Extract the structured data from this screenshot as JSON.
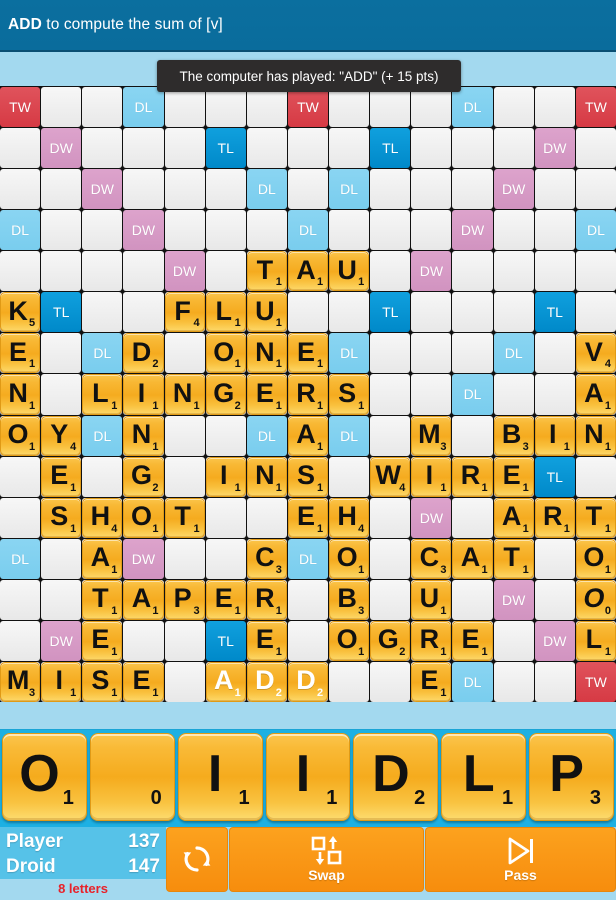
{
  "titlebar": {
    "clue_bold": "ADD",
    "clue_rest": " to compute the sum of [v]"
  },
  "toast": {
    "message": "The computer has played: \"ADD\" (+ 15 pts)"
  },
  "board": {
    "size": 15,
    "multiplier_labels": {
      "tw": "TW",
      "dw": "DW",
      "tl": "TL",
      "dl": "DL"
    },
    "colors": {
      "triple_word": "#d63a44",
      "double_word": "#d193c0",
      "triple_letter": "#0089c9",
      "double_letter": "#79cdee",
      "plain": "#eeeeee",
      "tile": "#f5ab1f",
      "grid_line": "#111111"
    },
    "multipliers": [
      [
        "tw",
        "",
        "",
        "dl",
        "",
        "",
        "",
        "tw",
        "",
        "",
        "",
        "dl",
        "",
        "",
        "tw"
      ],
      [
        "",
        "dw",
        "",
        "",
        "",
        "tl",
        "",
        "",
        "",
        "tl",
        "",
        "",
        "",
        "dw",
        ""
      ],
      [
        "",
        "",
        "dw",
        "",
        "",
        "",
        "dl",
        "",
        "dl",
        "",
        "",
        "",
        "dw",
        "",
        ""
      ],
      [
        "dl",
        "",
        "",
        "dw",
        "",
        "",
        "",
        "dl",
        "",
        "",
        "",
        "dw",
        "",
        "",
        "dl"
      ],
      [
        "",
        "",
        "",
        "",
        "dw",
        "",
        "",
        "",
        "",
        "",
        "dw",
        "",
        "",
        "",
        ""
      ],
      [
        "",
        "tl",
        "",
        "",
        "",
        "",
        "",
        "",
        "",
        "tl",
        "",
        "",
        "",
        "tl",
        ""
      ],
      [
        "",
        "",
        "dl",
        "",
        "",
        "",
        "",
        "",
        "dl",
        "",
        "",
        "",
        "dl",
        "",
        ""
      ],
      [
        "",
        "",
        "",
        "",
        "",
        "",
        "",
        "",
        "",
        "",
        "",
        "dl",
        "",
        "",
        ""
      ],
      [
        "",
        "",
        "dl",
        "",
        "",
        "",
        "dl",
        "",
        "dl",
        "",
        "",
        "",
        "",
        "",
        ""
      ],
      [
        "",
        "",
        "",
        "",
        "",
        "",
        "",
        "",
        "",
        "",
        "",
        "",
        "",
        "tl",
        ""
      ],
      [
        "",
        "",
        "",
        "",
        "",
        "",
        "",
        "",
        "",
        "",
        "dw",
        "",
        "",
        "",
        ""
      ],
      [
        "dl",
        "",
        "",
        "dw",
        "",
        "",
        "",
        "dl",
        "",
        "",
        "",
        "",
        "",
        "",
        ""
      ],
      [
        "",
        "",
        "",
        "",
        "",
        "",
        "",
        "",
        "",
        "",
        "",
        "",
        "dw",
        "",
        ""
      ],
      [
        "",
        "dw",
        "",
        "",
        "",
        "tl",
        "",
        "",
        "",
        "",
        "",
        "",
        "",
        "dw",
        ""
      ],
      [
        "",
        "",
        "",
        "",
        "",
        "",
        "",
        "",
        "",
        "",
        "",
        "dl",
        "",
        "",
        "tw"
      ]
    ],
    "tiles": [
      [
        "",
        "",
        "",
        "",
        "",
        "",
        "",
        "",
        "",
        "",
        "",
        "",
        "",
        "",
        ""
      ],
      [
        "",
        "",
        "",
        "",
        "",
        "",
        "",
        "",
        "",
        "",
        "",
        "",
        "",
        "",
        ""
      ],
      [
        "",
        "",
        "",
        "",
        "",
        "",
        "",
        "",
        "",
        "",
        "",
        "",
        "",
        "",
        ""
      ],
      [
        "",
        "",
        "",
        "",
        "",
        "",
        "",
        "",
        "",
        "",
        "",
        "",
        "",
        "",
        ""
      ],
      [
        "",
        "",
        "",
        "",
        "",
        "",
        "T1",
        "A1",
        "U1",
        "",
        "",
        "",
        "",
        "",
        ""
      ],
      [
        "K5",
        "",
        "",
        "",
        "F4",
        "L1",
        "U1",
        "",
        "",
        "",
        "",
        "",
        "",
        "",
        ""
      ],
      [
        "E1",
        "",
        "",
        "D2",
        "",
        "O1",
        "N1",
        "E1",
        "",
        "",
        "",
        "",
        "",
        "",
        "V4"
      ],
      [
        "N1",
        "",
        "L1",
        "I1",
        "N1",
        "G2",
        "E1",
        "R1",
        "S1",
        "",
        "",
        "",
        "",
        "",
        "A1"
      ],
      [
        "O1",
        "Y4",
        "",
        "N1",
        "",
        "",
        "",
        "A1",
        "",
        "",
        "M3",
        "",
        "B3",
        "I1",
        "N1"
      ],
      [
        "",
        "E1",
        "",
        "G2",
        "",
        "I1",
        "N1",
        "S1",
        "",
        "W4",
        "I1",
        "R1",
        "E1",
        "",
        ""
      ],
      [
        "",
        "S1",
        "H4",
        "O1",
        "T1",
        "",
        "",
        "E1",
        "H4",
        "",
        "",
        "",
        "A1",
        "R1",
        "T1"
      ],
      [
        "",
        "",
        "A1",
        "",
        "",
        "",
        "C3",
        "",
        "O1",
        "",
        "C3",
        "A1",
        "T1",
        "",
        "O1"
      ],
      [
        "",
        "",
        "T1",
        "A1",
        "P3",
        "E1",
        "R1",
        "",
        "B3",
        "",
        "U1",
        "",
        "",
        "",
        "*O0"
      ],
      [
        "",
        "",
        "E1",
        "",
        "",
        "",
        "E1",
        "",
        "O1",
        "G2",
        "R1",
        "E1",
        "",
        "",
        "L1"
      ],
      [
        "M3",
        "I1",
        "S1",
        "E1",
        "",
        "A1",
        "D2",
        "D2",
        "",
        "",
        "E1",
        "",
        "",
        "",
        ""
      ]
    ],
    "fresh_tiles": [
      [
        14,
        5
      ],
      [
        14,
        6
      ],
      [
        14,
        7
      ]
    ]
  },
  "rack": {
    "tiles": [
      {
        "letter": "O",
        "points": "1"
      },
      {
        "letter": "",
        "points": "0"
      },
      {
        "letter": "I",
        "points": "1"
      },
      {
        "letter": "I",
        "points": "1"
      },
      {
        "letter": "D",
        "points": "2"
      },
      {
        "letter": "L",
        "points": "1"
      },
      {
        "letter": "P",
        "points": "3"
      }
    ]
  },
  "bottom": {
    "player_name": "Player",
    "player_score": "137",
    "opponent_name": "Droid",
    "opponent_score": "147",
    "letters_left": "8  letters",
    "recall_label": "",
    "swap_label": "Swap",
    "pass_label": "Pass"
  }
}
